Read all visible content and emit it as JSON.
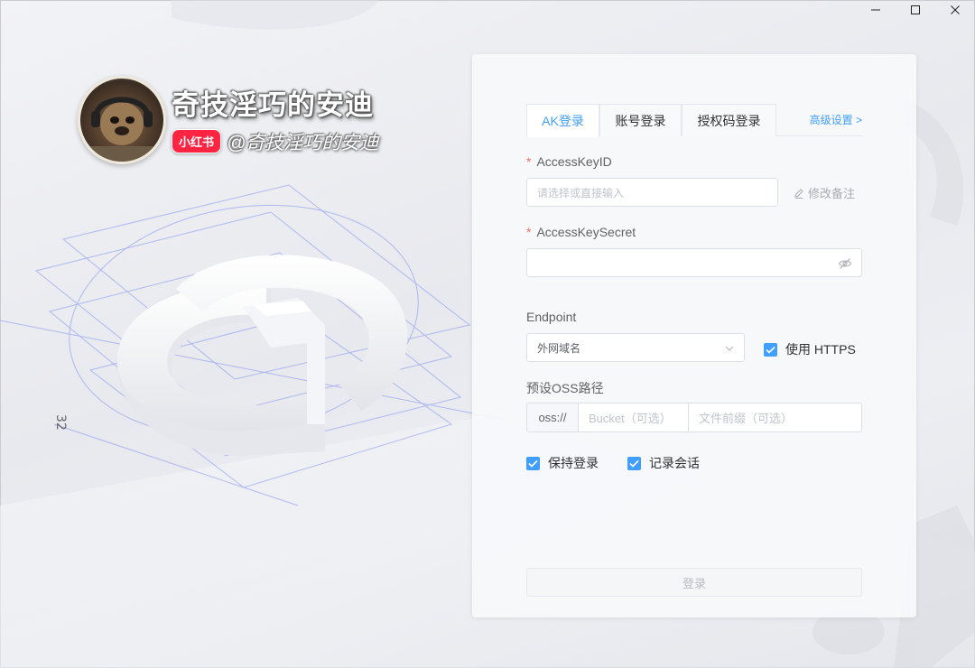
{
  "window": {
    "minimize_icon": "minimize-icon",
    "maximize_icon": "maximize-icon",
    "close_icon": "close-icon"
  },
  "brand": {
    "name": "奇技淫巧的安迪",
    "badge": "小红书",
    "handle": "@奇技淫巧的安迪"
  },
  "background": {
    "dimension_label": "32"
  },
  "login": {
    "tabs": [
      {
        "label": "AK登录",
        "active": true
      },
      {
        "label": "账号登录",
        "active": false
      },
      {
        "label": "授权码登录",
        "active": false
      }
    ],
    "advanced_label": "高级设置 >",
    "access_key_id": {
      "label": "AccessKeyID",
      "required_mark": "*",
      "placeholder": "请选择或直接输入",
      "value": ""
    },
    "remark_label": "修改备注",
    "access_key_secret": {
      "label": "AccessKeySecret",
      "required_mark": "*",
      "value": ""
    },
    "endpoint": {
      "label": "Endpoint",
      "selected": "外网域名"
    },
    "https": {
      "label": "使用 HTTPS",
      "checked": true
    },
    "oss_path": {
      "label": "预设OSS路径",
      "prefix": "oss://",
      "bucket_placeholder": "Bucket（可选）",
      "prefix_placeholder": "文件前缀（可选）"
    },
    "keep_login": {
      "label": "保持登录",
      "checked": true
    },
    "record_session": {
      "label": "记录会话",
      "checked": true
    },
    "submit_label": "登录"
  },
  "colors": {
    "accent": "#409eff",
    "required": "#f56c6c",
    "badge": "#ff2442"
  }
}
